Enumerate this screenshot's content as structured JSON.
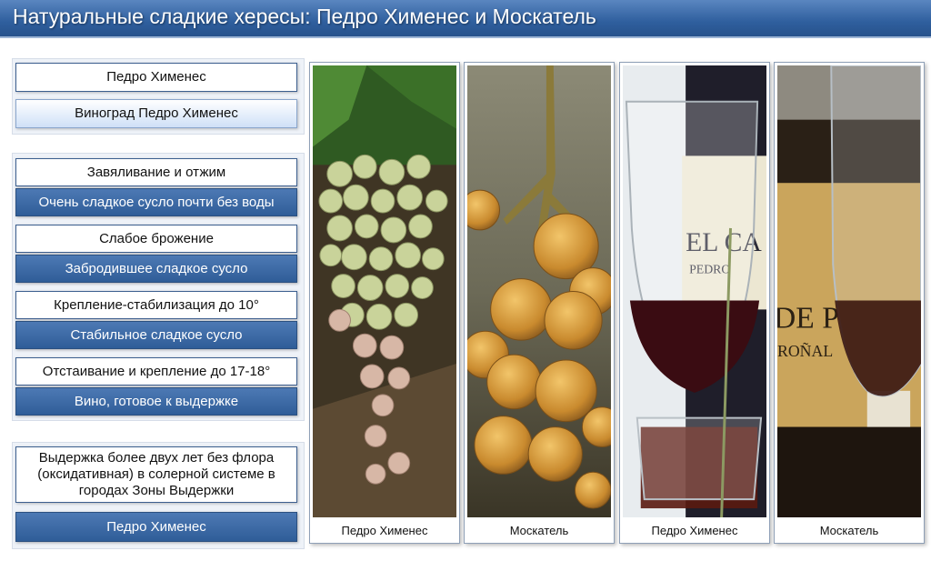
{
  "slide": {
    "title": "Натуральные сладкие хересы: Педро Хименес и Москатель"
  },
  "process": {
    "heading": "Педро Хименес",
    "grape": "Виноград Педро Хименес",
    "steps": [
      {
        "action": "Завяливание и отжим",
        "result": "Очень сладкое сусло почти без воды"
      },
      {
        "action": "Слабое брожение",
        "result": "Забродившее сладкое сусло"
      },
      {
        "action": "Крепление-стабилизация до 10°",
        "result": "Стабильное сладкое сусло"
      },
      {
        "action": "Отстаивание и крепление до 17-18°",
        "result": "Вино, готовое к выдержке"
      }
    ],
    "aging": "Выдержка более двух лет без флора (оксидативная) в солерной системе в городах Зоны Выдержки",
    "final": "Педро Хименес"
  },
  "photos": [
    {
      "caption": "Педро Хименес"
    },
    {
      "caption": "Москатель"
    },
    {
      "caption": "Педро Хименес",
      "label_text": "EL CA",
      "label_sub": "PEDRO"
    },
    {
      "caption": "Москатель",
      "label_text": "DE P",
      "label_sub": "ROÑAL"
    }
  ]
}
